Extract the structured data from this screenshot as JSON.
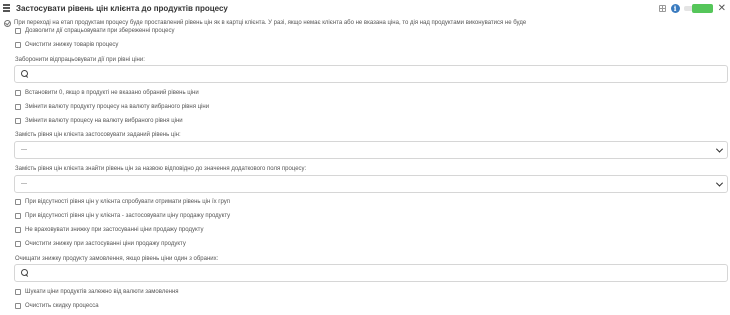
{
  "header": {
    "title": "Застосувати рівень цін клієнта до продуктів процесу"
  },
  "note": "При переході на етап продуктам процесу буде проставлений рівень цін як в картці клієнта. У разі, якщо немає клієнта або не вказана ціна, то дія над продуктами виконуватися не буде",
  "options_top": [
    "Дозволити дії спрацьовувати при збереженні процесу",
    "Очистити знижку товарів процесу"
  ],
  "forbid_label": "Заборонити відпрацьовувати дії при рівні ціни:",
  "options_mid": [
    "Встановити 0, якщо в продукті не вказано обраний рівень ціни",
    "Змінити валюту продукту процесу на валюту вибраного рівня ціни",
    "Змінити валюту процесу на валюту вибраного рівня ціни"
  ],
  "select1": {
    "label": "Замість рівня цін клієнта застосовувати заданий рівень цін:",
    "value": "---"
  },
  "select2": {
    "label": "Замість рівня цін клієнта знайти рівень цін за назвою відповідно до значення додаткового поля процесу:",
    "value": "---"
  },
  "options_low": [
    "При відсутності рівня цін у клієнта спробувати отримати рівень цін їх груп",
    "При відсутності рівня цін у клієнта - застосовувати ціну продажу продукту",
    "Не враховувати знижку при застосуванні ціни продажу продукту",
    "Очистити знижку при застосуванні ціни продажу продукту"
  ],
  "clear_label": "Очищати знижку продукту замовлення, якщо рівень ціни один з обраних:",
  "options_bottom": [
    "Шукати ціни продуктів залежно від валюти замовлення",
    "Очистить скидку процесса"
  ],
  "colors": {
    "toggle_on": "#55c65a",
    "info": "#3a7bbf"
  },
  "icons": [
    "drag-handle-icon",
    "grid-icon",
    "info-icon",
    "close-icon",
    "check-circle-icon",
    "search-icon",
    "chevron-down-icon"
  ]
}
